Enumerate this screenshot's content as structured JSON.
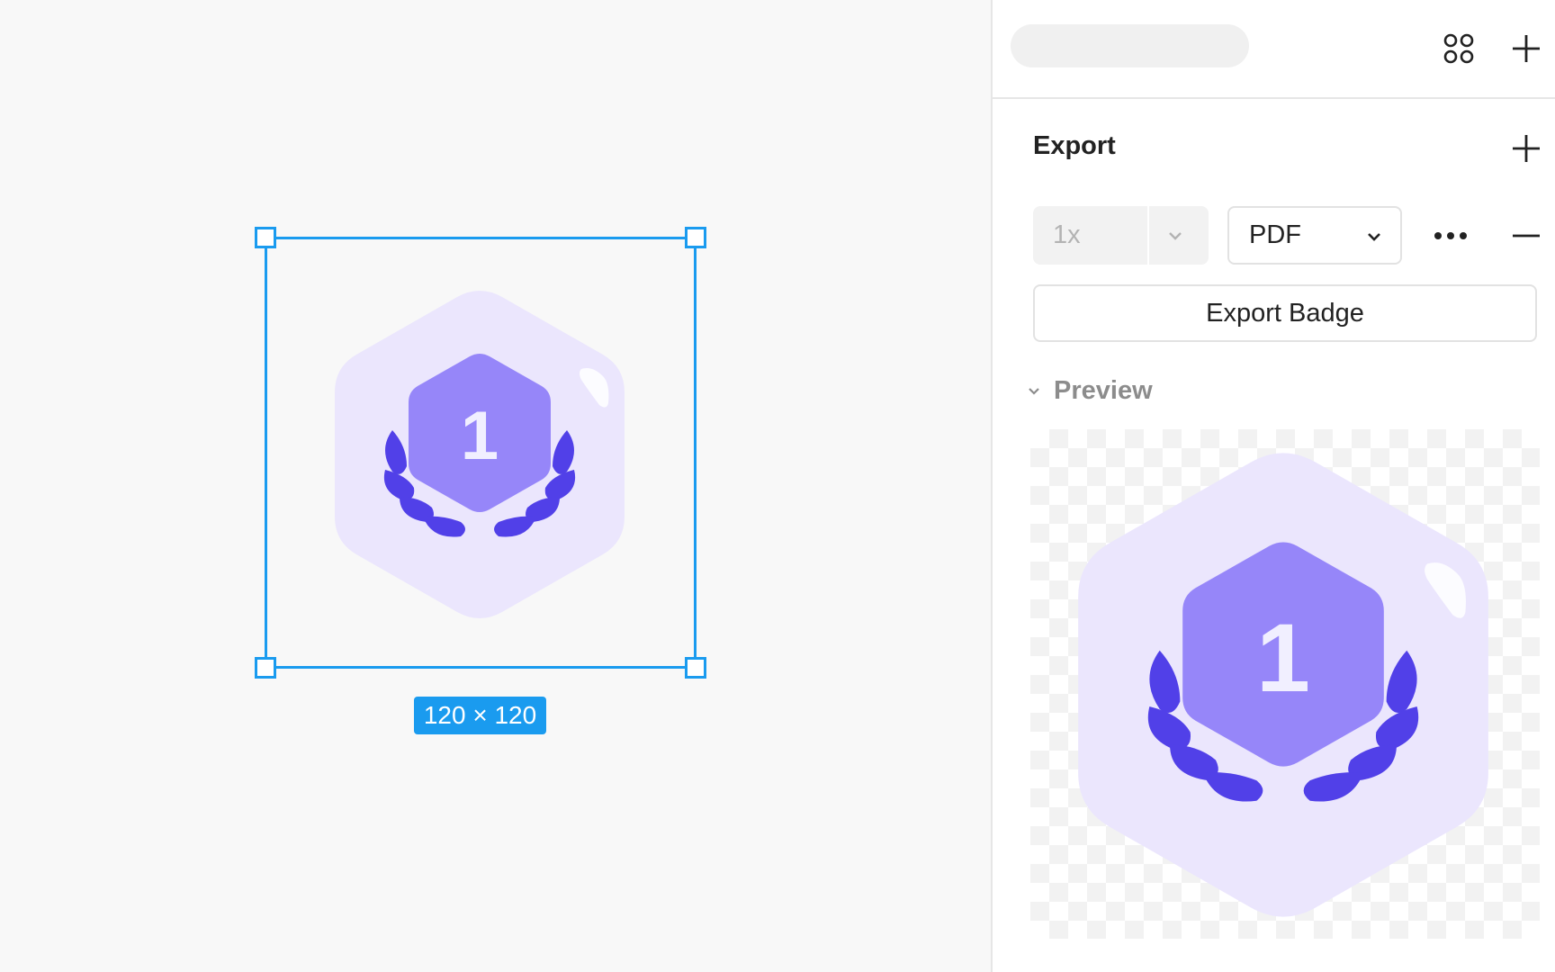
{
  "canvas": {
    "selection_size_label": "120 × 120",
    "badge_number": "1"
  },
  "panel": {
    "toolbar": {
      "components_icon": "components-grid-icon",
      "add_icon": "plus-icon"
    },
    "export": {
      "title": "Export",
      "scale_value": "1x",
      "format_value": "PDF",
      "export_button_label": "Export Badge"
    },
    "preview": {
      "label": "Preview",
      "badge_number": "1"
    }
  },
  "colors": {
    "selection": "#1a9bef",
    "badge_outer": "#ebe6fd",
    "badge_inner": "#9686f9",
    "laurel": "#5140e8",
    "number": "#f1efff"
  }
}
